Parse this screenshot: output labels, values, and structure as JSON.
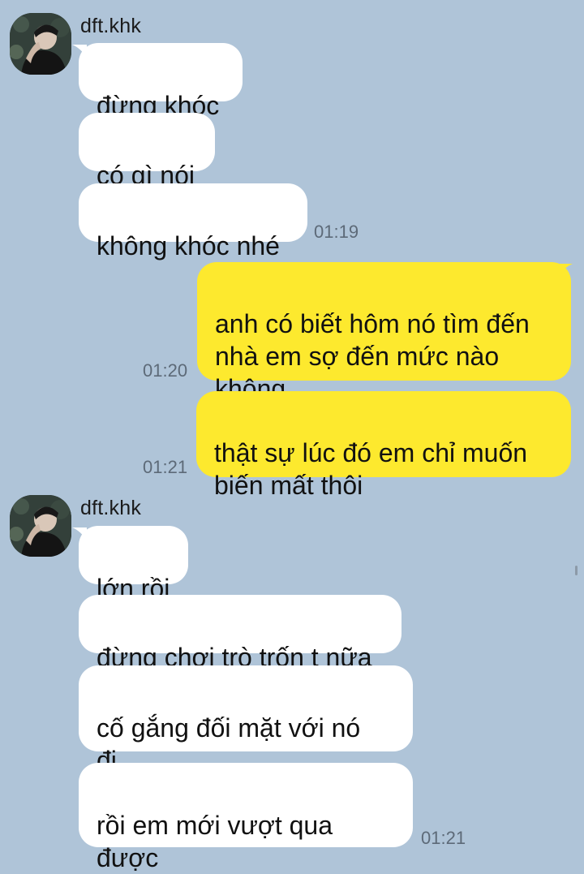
{
  "chat": {
    "groups": [
      {
        "sender": "dft.khk",
        "direction": "incoming",
        "messages": [
          "đừng khóc",
          "có gì nói",
          "không khóc nhé"
        ],
        "time": "01:19"
      },
      {
        "direction": "outgoing",
        "messages": [
          "anh có biết hôm nó tìm đến\nnhà em sợ đến mức nào\nkhông"
        ],
        "time": "01:20"
      },
      {
        "direction": "outgoing",
        "messages": [
          "thật sự lúc đó em chỉ muốn\nbiến mất thôi"
        ],
        "time": "01:21"
      },
      {
        "sender": "dft.khk",
        "direction": "incoming",
        "messages": [
          "lớn rồi",
          "đừng chơi trò trốn t nữa",
          "cố gắng đối mặt với nó\nđi",
          "rồi em mới vượt qua\nđược"
        ],
        "time": "01:21"
      }
    ]
  },
  "colors": {
    "background": "#afc4d8",
    "incoming_bubble": "#ffffff",
    "outgoing_bubble": "#fde92e",
    "timestamp": "#5d6a78"
  },
  "icons": [
    "avatar-photo",
    "scroll-indicator"
  ]
}
